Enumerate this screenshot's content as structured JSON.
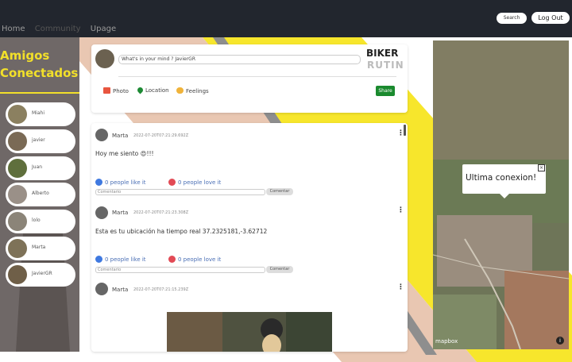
{
  "nav": {
    "home": "Home",
    "community": "Community",
    "upage": "Upage"
  },
  "header": {
    "search_label": "Search",
    "logout_label": "Log Out"
  },
  "sidebar": {
    "title_line1": "Amigos",
    "title_line2": "Conectados",
    "friends": [
      "Miahi",
      "javier",
      "Juan",
      "Alberto",
      "lolo",
      "Marta",
      "JavierGR"
    ]
  },
  "composer": {
    "placeholder": "What's in your mind ? JavierGR",
    "logo_line1": "BIKER",
    "logo_line2": "RUTIN",
    "photo_label": "Photo",
    "location_label": "Location",
    "feelings_label": "Feelings",
    "share_label": "Share"
  },
  "posts": [
    {
      "user": "Marta",
      "date": "2022-07-20T07:21:29.692Z",
      "text": "Hoy me siento 😍!!!",
      "likes": "0 people like it",
      "loves": "0 people love it",
      "comment_placeholder": "Comentario",
      "comment_button": "Comentar"
    },
    {
      "user": "Marta",
      "date": "2022-07-20T07:21:23.308Z",
      "text": "Esta es tu ubicación ha tiempo real 37.2325181,-3.62712",
      "likes": "0 people like it",
      "loves": "0 people love it",
      "comment_placeholder": "Comentario",
      "comment_button": "Comentar"
    },
    {
      "user": "Marta",
      "date": "2022-07-20T07:21:15.239Z"
    }
  ],
  "map": {
    "popup_text": "Ultima conexion!",
    "close_symbol": "×",
    "attribution": "mapbox",
    "info_symbol": "i"
  },
  "colors": {
    "accent_yellow": "#f2e02a",
    "sidebar_bg": "#6f6867",
    "topbar_bg": "#22262e",
    "share_green": "#1a8a2e"
  }
}
